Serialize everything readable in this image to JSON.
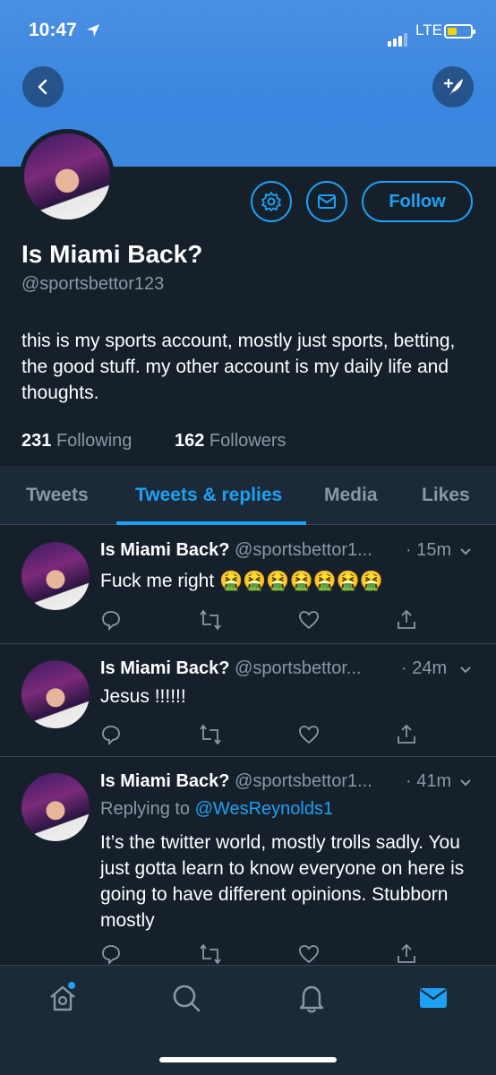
{
  "status_bar": {
    "time": "10:47",
    "network": "LTE"
  },
  "profile": {
    "name": "Is Miami Back?",
    "handle": "@sportsbettor123",
    "bio": "this is my sports account, mostly just sports, betting, the good stuff. my other account is my daily life and thoughts.",
    "following_count": "231",
    "following_label": "Following",
    "followers_count": "162",
    "followers_label": "Followers",
    "follow_label": "Follow"
  },
  "tabs": [
    {
      "label": "Tweets"
    },
    {
      "label": "Tweets & replies",
      "active": true
    },
    {
      "label": "Media"
    },
    {
      "label": "Likes"
    }
  ],
  "tweets": [
    {
      "name": "Is Miami Back?",
      "handle": "@sportsbettor1...",
      "time": "· 15m",
      "text": "Fuck me right 🤮🤮🤮🤮🤮🤮🤮"
    },
    {
      "name": "Is Miami Back?",
      "handle": "@sportsbettor...",
      "time": "· 24m",
      "text": "Jesus !!!!!!"
    },
    {
      "name": "Is Miami Back?",
      "handle": "@sportsbettor1...",
      "time": "· 41m",
      "replying_prefix": "Replying to",
      "replying_to": "@WesReynolds1",
      "text": "It’s the twitter world, mostly trolls sadly. You just gotta learn to know everyone on here is going to have different opinions. Stubborn mostly"
    }
  ],
  "colors": {
    "accent": "#1da1f2",
    "background": "#15202b",
    "banner": "#3b86e0"
  }
}
